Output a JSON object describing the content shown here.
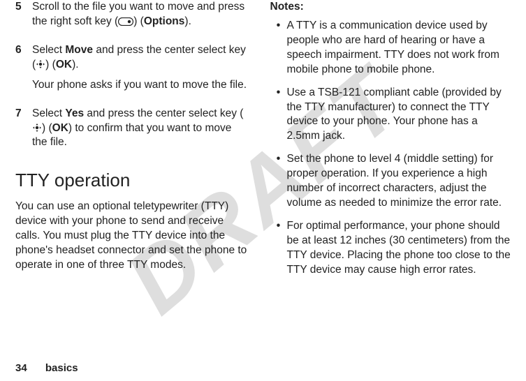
{
  "watermark": "DRAFT",
  "left": {
    "steps": [
      {
        "num": "5",
        "paras": [
          [
            {
              "t": "Scroll to the file you want to move and press the right soft key ("
            },
            {
              "icon": "softkey-right"
            },
            {
              "t": ") ("
            },
            {
              "b": "Options"
            },
            {
              "t": ")."
            }
          ]
        ]
      },
      {
        "num": "6",
        "paras": [
          [
            {
              "t": "Select "
            },
            {
              "b": "Move"
            },
            {
              "t": " and press the center select key ("
            },
            {
              "icon": "center-select"
            },
            {
              "t": ") ("
            },
            {
              "b": "OK"
            },
            {
              "t": ")."
            }
          ],
          [
            {
              "t": "Your phone asks if you want to move the file."
            }
          ]
        ]
      },
      {
        "num": "7",
        "paras": [
          [
            {
              "t": "Select "
            },
            {
              "b": "Yes"
            },
            {
              "t": " and press the center select key ("
            },
            {
              "icon": "center-select"
            },
            {
              "t": ") ("
            },
            {
              "b": "OK"
            },
            {
              "t": ") to confirm that you want to move the file."
            }
          ]
        ]
      }
    ],
    "heading": "TTY operation",
    "intro": "You can use an optional teletypewriter (TTY) device with your phone to send and receive calls. You must plug the TTY device into the phone's headset connector and set the phone to operate in one of three TTY modes."
  },
  "right": {
    "notesLabel": "Notes:",
    "bullets": [
      "A TTY is a communication device used by people who are hard of hearing or have a speech impairment. TTY does not work from mobile phone to mobile phone.",
      "Use a TSB-121 compliant cable (provided by the TTY manufacturer) to connect the TTY device to your phone. Your phone has a 2.5mm jack.",
      "Set the phone to level 4 (middle setting) for proper operation. If you experience a high number of incorrect characters, adjust the volume as needed to minimize the error rate.",
      "For optimal performance, your phone should be at least 12 inches (30 centimeters) from the TTY device. Placing the phone too close to the TTY device may cause high error rates."
    ]
  },
  "footer": {
    "page": "34",
    "section": "basics"
  },
  "icons": {
    "softkey-right": "softkey-right-icon",
    "center-select": "center-select-icon"
  }
}
